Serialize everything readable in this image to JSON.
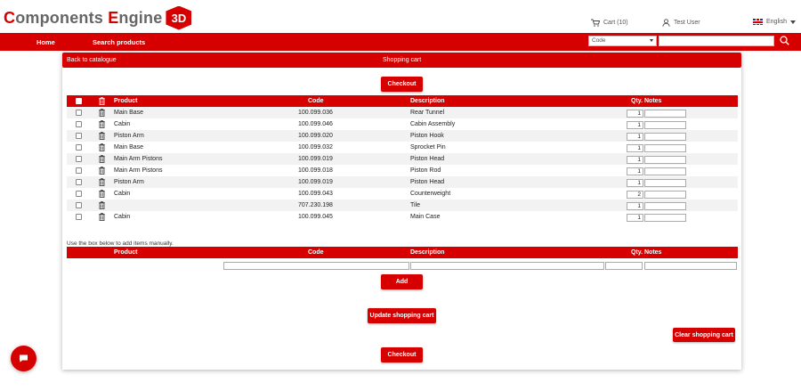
{
  "header": {
    "logo": {
      "part1_initial": "C",
      "part1_rest": "omponents ",
      "part2_initial": "E",
      "part2_rest": "ngine",
      "cube_text": "3D"
    },
    "cart_label": "Cart (10)",
    "user_label": "Test User",
    "language_label": "English"
  },
  "nav": {
    "home": "Home",
    "search_products": "Search products",
    "search_select_value": "Code",
    "search_input_value": ""
  },
  "panel": {
    "back_link": "Back to catalogue",
    "title": "Shopping cart",
    "checkout_top": "Checkout",
    "checkout_bottom": "Checkout",
    "columns": {
      "product": "Product",
      "code": "Code",
      "description": "Description",
      "qty": "Qty.",
      "notes": "Notes"
    },
    "rows": [
      {
        "product": "Main Base",
        "code": "100.099.036",
        "description": "Rear Tunnel",
        "qty": "1"
      },
      {
        "product": "Cabin",
        "code": "100.099.046",
        "description": "Cabin Assembly",
        "qty": "1"
      },
      {
        "product": "Piston Arm",
        "code": "100.099.020",
        "description": "Piston Hook",
        "qty": "1"
      },
      {
        "product": "Main Base",
        "code": "100.099.032",
        "description": "Sprocket Pin",
        "qty": "1"
      },
      {
        "product": "Main Arm Pistons",
        "code": "100.099.019",
        "description": "Piston Head",
        "qty": "1"
      },
      {
        "product": "Main Arm Pistons",
        "code": "100.099.018",
        "description": "Piston Rod",
        "qty": "1"
      },
      {
        "product": "Piston Arm",
        "code": "100.099.019",
        "description": "Piston Head",
        "qty": "1"
      },
      {
        "product": "Cabin",
        "code": "100.099.043",
        "description": "Counterweight",
        "qty": "2"
      },
      {
        "product": "",
        "code": "707.230.198",
        "description": "Tile",
        "qty": "1"
      },
      {
        "product": "Cabin",
        "code": "100.099.045",
        "description": "Main Case",
        "qty": "1"
      }
    ],
    "manual_note": "Use the box below to add items manually.",
    "add_button": "Add",
    "update_button": "Update shopping cart",
    "clear_button": "Clear shopping cart"
  },
  "colors": {
    "accent": "#d60000",
    "row_stripe": "#f2f2f2"
  }
}
